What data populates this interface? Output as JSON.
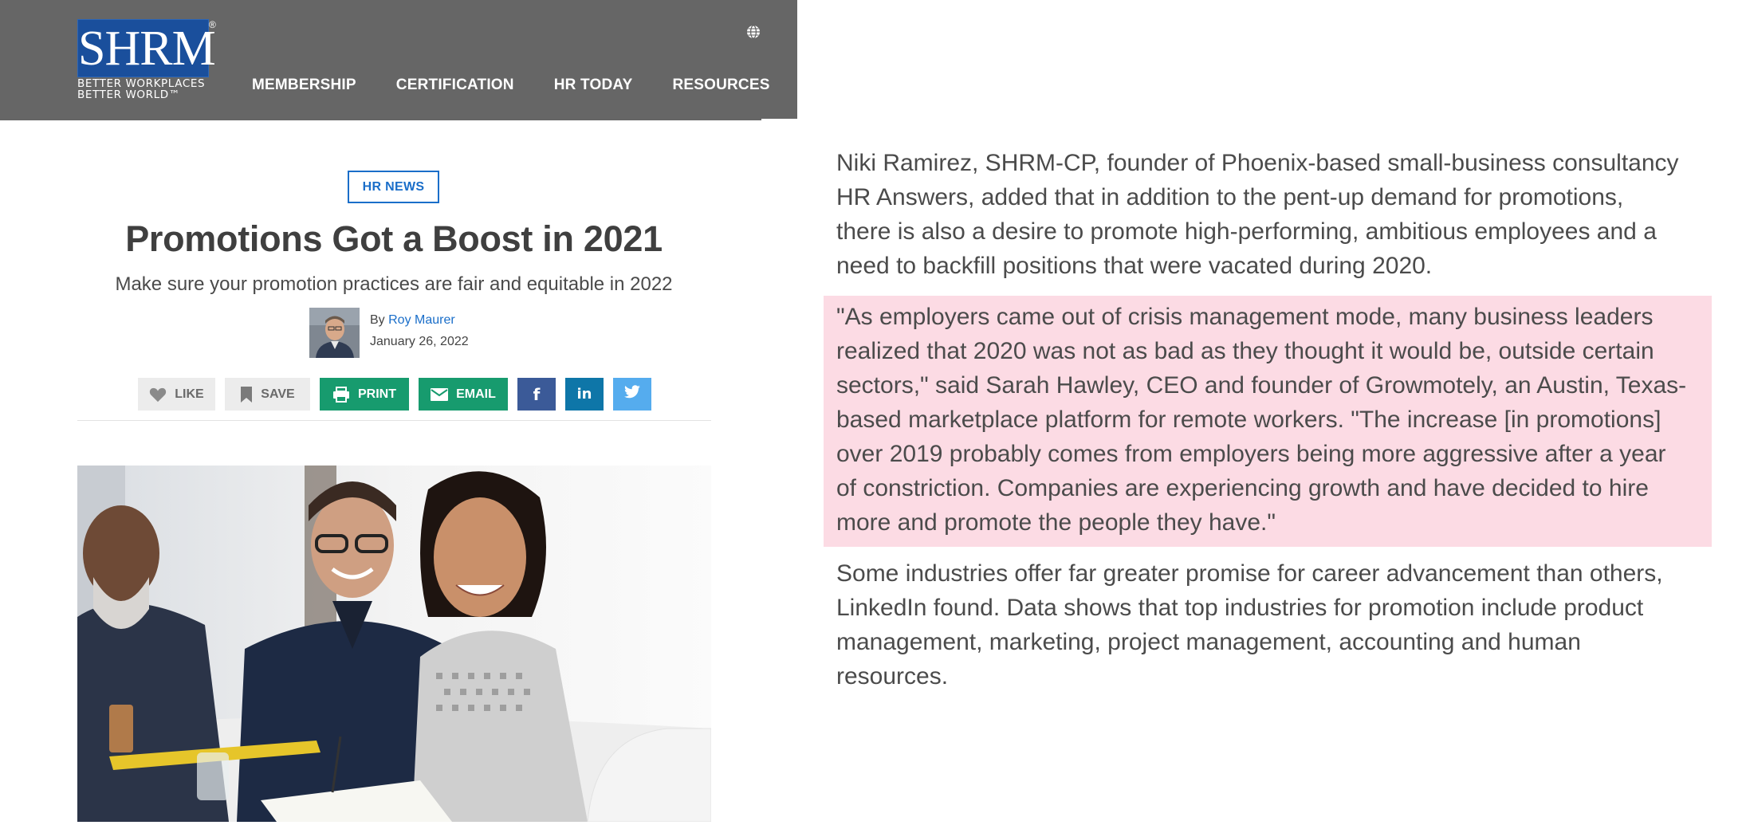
{
  "header": {
    "logo_text": "SHRM",
    "logo_registered": "®",
    "logo_tagline_1": "BETTER WORKPLACES",
    "logo_tagline_2": "BETTER WORLD™",
    "nav": [
      "MEMBERSHIP",
      "CERTIFICATION",
      "HR TODAY",
      "RESOURCES"
    ],
    "globe_icon": "globe-icon"
  },
  "article": {
    "category": "HR NEWS",
    "title": "Promotions Got a Boost in 2021",
    "subtitle": "Make sure your promotion practices are fair and equitable in 2022",
    "by_prefix": "By",
    "author": "Roy Maurer",
    "date": "January 26, 2022"
  },
  "actions": {
    "like": "LIKE",
    "save": "SAVE",
    "print": "PRINT",
    "email": "EMAIL",
    "facebook_icon": "facebook-icon",
    "linkedin_icon": "linkedin-icon",
    "twitter_icon": "twitter-icon"
  },
  "colors": {
    "header_bg": "#666666",
    "accent_blue": "#1a6ec9",
    "green": "#179b6e",
    "facebook": "#3b5a98",
    "linkedin": "#0e76a8",
    "twitter": "#55acee",
    "highlight": "#fcdbe4"
  },
  "excerpt": {
    "p1_lines": [
      "Niki Ramirez, SHRM-CP, founder of Phoenix-based small-business consultancy",
      "HR Answers, added that in addition to the pent-up demand for promotions,",
      "there is also a desire to promote high-performing, ambitious employees and a",
      "need to backfill positions that were vacated during 2020."
    ],
    "p2_lines": [
      "\"As employers came out of crisis management mode, many business leaders",
      "realized that 2020 was not as bad as they thought it would be, outside certain",
      "sectors,\" said Sarah Hawley, CEO and founder of Growmotely, an Austin, Texas-",
      "based marketplace platform for remote workers. \"The increase [in promotions]",
      "over 2019 probably comes from employers being more aggressive after a year",
      "of constriction. Companies are experiencing growth and have decided to hire",
      "more and promote the people they have.\""
    ],
    "p3_lines": [
      "Some industries offer far greater promise for career advancement than others,",
      "LinkedIn found. Data shows that top industries for promotion include product",
      "management, marketing, project management, accounting and human",
      "resources."
    ]
  }
}
